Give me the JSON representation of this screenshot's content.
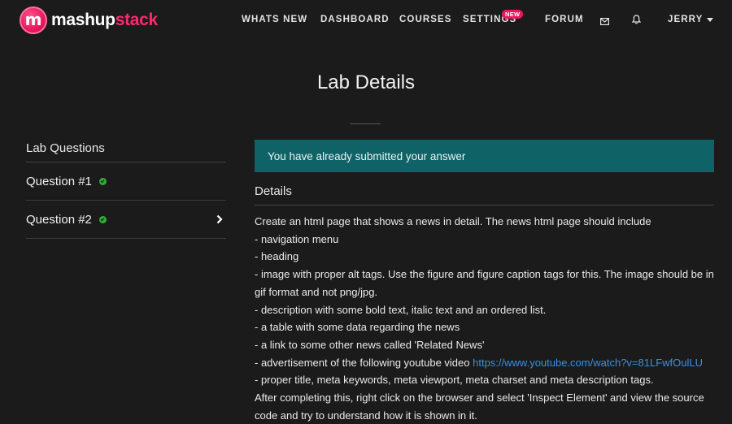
{
  "brand": {
    "part1": "mashup",
    "part2": "stack",
    "mark": "m"
  },
  "nav": {
    "items": [
      "WHATS NEW",
      "DASHBOARD",
      "COURSES",
      "SETTINGS",
      "FORUM"
    ],
    "settings_badge": "NEW",
    "user": "JERRY",
    "icons": [
      "mail-icon",
      "bell-icon"
    ]
  },
  "page": {
    "title": "Lab Details"
  },
  "sidebar": {
    "heading": "Lab Questions",
    "questions": [
      {
        "label": "Question #1",
        "status": "completed"
      },
      {
        "label": "Question #2",
        "status": "completed",
        "active": true
      }
    ]
  },
  "main": {
    "alert": "You have already submitted your answer",
    "details_heading": "Details",
    "lines": [
      "Create an html page that shows a news in detail. The news html page should include",
      "- navigation menu",
      "- heading",
      "- image with proper alt tags. Use the figure and figure caption tags for this. The image should be in gif format and not png/jpg.",
      "- description with some bold text, italic text and an ordered list.",
      "- a table with some data regarding the news",
      "- a link to some other news called 'Related News'",
      "- advertisement of the following youtube video ",
      "- proper title, meta keywords, meta viewport, meta charset and meta description tags.",
      "After completing this, right click on the browser and select 'Inspect Element' and view the source code and try to understand how it is shown in it."
    ],
    "video_link": "https://www.youtube.com/watch?v=81LFwfOulLU"
  },
  "colors": {
    "accent": "#e8185f",
    "alert_bg": "#0f6266",
    "link": "#3b8fe0",
    "check": "#2fae35",
    "background": "#1b1b1b"
  }
}
